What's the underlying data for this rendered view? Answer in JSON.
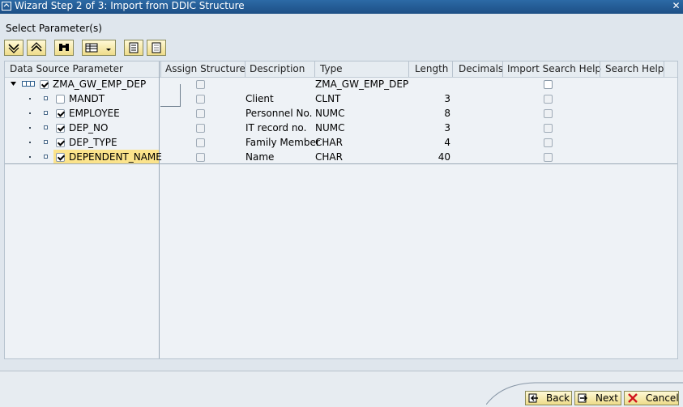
{
  "window": {
    "title": "Wizard Step 2 of 3: Import from DDIC Structure"
  },
  "section": {
    "label": "Select Parameter(s)"
  },
  "columns": {
    "data_source_parameter": "Data Source Parameter",
    "assign_structure": "Assign Structure",
    "description": "Description",
    "type": "Type",
    "length": "Length",
    "decimals": "Decimals",
    "import_search_help": "Import Search Help",
    "search_help": "Search Help"
  },
  "root": {
    "name": "ZMA_GW_EMP_DEP",
    "type": "ZMA_GW_EMP_DEP",
    "checked": true
  },
  "rows": [
    {
      "name": "MANDT",
      "description": "Client",
      "type": "CLNT",
      "length": "3",
      "checked": false
    },
    {
      "name": "EMPLOYEE",
      "description": "Personnel No.",
      "type": "NUMC",
      "length": "8",
      "checked": true
    },
    {
      "name": "DEP_NO",
      "description": "IT record no.",
      "type": "NUMC",
      "length": "3",
      "checked": true
    },
    {
      "name": "DEP_TYPE",
      "description": "Family Member",
      "type": "CHAR",
      "length": "4",
      "checked": true
    },
    {
      "name": "DEPENDENT_NAME",
      "description": "Name",
      "type": "CHAR",
      "length": "40",
      "checked": true
    }
  ],
  "footer": {
    "back": "Back",
    "next": "Next",
    "cancel": "Cancel"
  },
  "colors": {
    "titlebar": "#1d4f85",
    "highlight": "#fbe38b",
    "cancel_icon": "#d0141e"
  }
}
